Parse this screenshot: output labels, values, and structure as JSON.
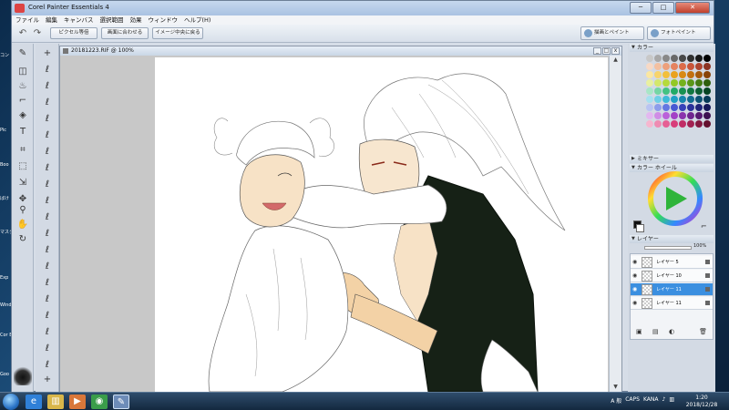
{
  "app": {
    "title": "Corel Painter Essentials 4"
  },
  "desktop_icons": [
    "コン",
    "Pic",
    "Boo",
    "ばけ\nフォル",
    "マスタ\nサー",
    "Exp",
    "Wind",
    "Cor\nEs",
    "Goo"
  ],
  "menu": [
    "ファイル",
    "編集",
    "キャンバス",
    "選択範囲",
    "効果",
    "ウィンドウ",
    "ヘルプ(H)"
  ],
  "toolbar": {
    "buttons": [
      "ピクセル等倍",
      "画面に合わせる",
      "イメージ中央に戻る"
    ],
    "modes": [
      "描画とペイント",
      "フォトペイント"
    ]
  },
  "document": {
    "title": "20181223.RIF @ 100%"
  },
  "panels": {
    "color_title": "カラー",
    "mixer_title": "ミキサー",
    "wheel_title": "カラー ホイール",
    "layers_title": "レイヤー",
    "opacity": "100%",
    "layers": [
      {
        "name": "レイヤー 5"
      },
      {
        "name": "レイヤー 10"
      },
      {
        "name": "レイヤー 11"
      },
      {
        "name": "レイヤー 11"
      }
    ]
  },
  "swatch_colors": [
    "#c8c8c8",
    "#a8a8a8",
    "#888888",
    "#686868",
    "#484848",
    "#303030",
    "#181818",
    "#000000",
    "#f7d9c6",
    "#f3c0a1",
    "#eda07c",
    "#e5825f",
    "#dc6b49",
    "#c8553a",
    "#ad4530",
    "#8c3423",
    "#fbe7a1",
    "#f7d46b",
    "#f2bf3c",
    "#eaa21f",
    "#d98914",
    "#c27010",
    "#a55a0d",
    "#884409",
    "#e9f0a0",
    "#d4e86b",
    "#b6da3c",
    "#93c826",
    "#74b21d",
    "#5a9617",
    "#447a12",
    "#2f5e0d",
    "#a8e6c6",
    "#74d6a4",
    "#43c282",
    "#22aa67",
    "#189152",
    "#117740",
    "#0c5e31",
    "#074423",
    "#a6e0ef",
    "#6fcfe6",
    "#3fbad8",
    "#1fa0c6",
    "#1786ae",
    "#116c91",
    "#0c5374",
    "#073a57",
    "#b9c4f2",
    "#8d9deb",
    "#6477e2",
    "#4758d3",
    "#3742b9",
    "#2b329a",
    "#21257a",
    "#161859",
    "#e3b8f0",
    "#d08de6",
    "#ba61d9",
    "#a342c6",
    "#8a32ad",
    "#6f258f",
    "#561b70",
    "#3c1150",
    "#f6b6cf",
    "#ef8bb2",
    "#e65f94",
    "#d83e7a",
    "#c02d65",
    "#a22252",
    "#831940",
    "#63102e"
  ],
  "taskbar": {
    "apps": [
      "internet-explorer",
      "file-explorer",
      "media-player",
      "chrome",
      "painter"
    ],
    "tray_text": [
      "A 般",
      "CAPS",
      "KANA"
    ],
    "time": "1:20",
    "date": "2018/12/28"
  }
}
